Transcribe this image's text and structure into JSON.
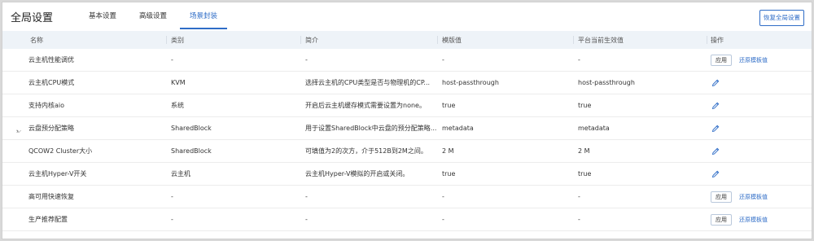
{
  "page_title": "全局设置",
  "tabs": [
    {
      "label": "基本设置",
      "active": false
    },
    {
      "label": "高级设置",
      "active": false
    },
    {
      "label": "场景封装",
      "active": true
    }
  ],
  "restore_all_button": "恢复全局设置",
  "columns": [
    "名称",
    "类别",
    "简介",
    "模版值",
    "平台当前生效值",
    "操作"
  ],
  "actions": {
    "apply": "应用",
    "restore": "还原模板值"
  },
  "accent_color": "#2f6dc7",
  "groups": [
    {
      "name": "云主机性能调优",
      "category": "-",
      "description": "-",
      "template_value": "-",
      "current_value": "-",
      "expanded": true,
      "rows": [
        {
          "name": "云主机CPU模式",
          "category": "KVM",
          "description": "选择云主机的CPU类型是否与物理机的CP...",
          "template_value": "host-passthrough",
          "current_value": "host-passthrough"
        },
        {
          "name": "支持内核aio",
          "category": "系统",
          "description": "开启后云主机缓存模式需要设置为none。",
          "template_value": "true",
          "current_value": "true"
        },
        {
          "name": "云盘预分配策略",
          "category": "SharedBlock",
          "description": "用于设置SharedBlock中云盘的预分配策略...",
          "template_value": "metadata",
          "current_value": "metadata"
        },
        {
          "name": "QCOW2 Cluster大小",
          "category": "SharedBlock",
          "description": "可填值为2的次方，介于512B到2M之间。",
          "template_value": "2 M",
          "current_value": "2 M"
        },
        {
          "name": "云主机Hyper-V开关",
          "category": "云主机",
          "description": "云主机Hyper-V模拟的开启或关闭。",
          "template_value": "true",
          "current_value": "true"
        }
      ]
    },
    {
      "name": "高可用快速恢复",
      "category": "-",
      "description": "-",
      "template_value": "-",
      "current_value": "-",
      "expanded": false,
      "rows": []
    },
    {
      "name": "生产推荐配置",
      "category": "-",
      "description": "-",
      "template_value": "-",
      "current_value": "-",
      "expanded": false,
      "rows": []
    }
  ]
}
